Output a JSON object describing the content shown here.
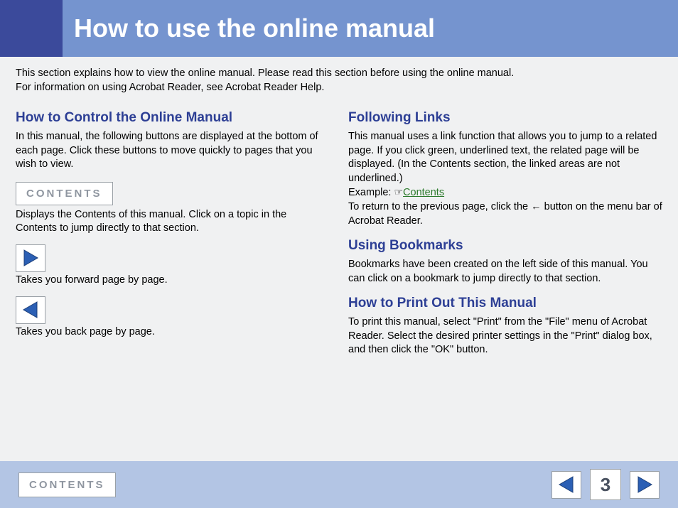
{
  "header": {
    "title": "How to use the online manual"
  },
  "intro": {
    "line1": "This section explains how to view the online manual. Please read this section before using the online manual.",
    "line2": "For information on using Acrobat Reader, see Acrobat Reader Help."
  },
  "left": {
    "heading1": "How to Control the Online Manual",
    "para1": "In this manual, the following buttons are displayed at the bottom of each page. Click these buttons to move quickly to pages that you wish to view.",
    "contents_button": "CONTENTS",
    "contents_desc": "Displays the Contents of this manual. Click on a topic in the Contents to jump directly to that section.",
    "forward_desc": "Takes you forward page by page.",
    "back_desc": "Takes you back page by page."
  },
  "right": {
    "heading1": "Following Links",
    "links_para_a": "This manual uses a link function that allows you to jump to a related page. If you click green, underlined text, the related page will be displayed. (In the Contents section, the linked areas are not underlined.)",
    "example_label": "Example: ",
    "example_link": "Contents",
    "links_para_b": "To return to the previous page, click the ",
    "links_para_c": " button on the menu bar of Acrobat Reader.",
    "heading2": "Using Bookmarks",
    "bookmarks_para": "Bookmarks have been created on the left side of this manual. You can click on a bookmark to jump directly to that section.",
    "heading3": "How to Print Out This Manual",
    "print_para": "To print this manual, select \"Print\" from the \"File\" menu of Acrobat Reader. Select the desired printer settings in the \"Print\" dialog box, and then click the \"OK\" button."
  },
  "footer": {
    "contents": "CONTENTS",
    "page": "3"
  }
}
